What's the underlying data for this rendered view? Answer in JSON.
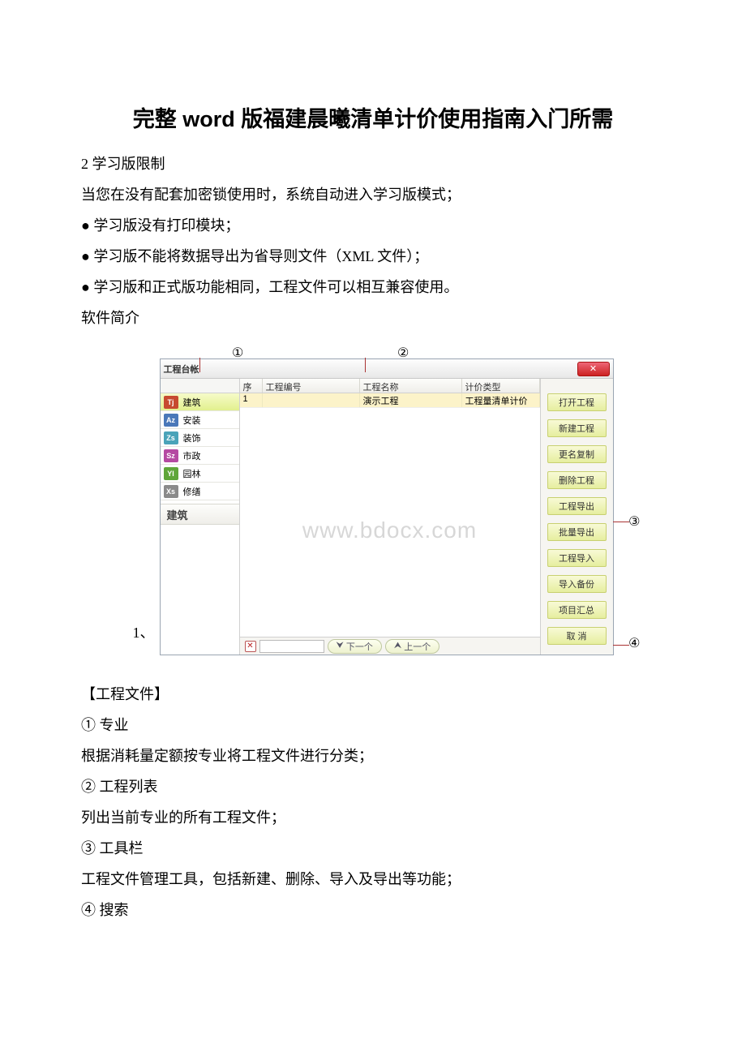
{
  "title": "完整 word 版福建晨曦清单计价使用指南入门所需",
  "intro": {
    "p1": "2 学习版限制",
    "p2": "当您在没有配套加密锁使用时，系统自动进入学习版模式；",
    "b1": "● 学习版没有打印模块；",
    "b2": "● 学习版不能将数据导出为省导则文件（XML 文件）；",
    "b3": "● 学习版和正式版功能相同，工程文件可以相互兼容使用。",
    "p3": "软件简介"
  },
  "markers": {
    "m1": "①",
    "m2": "②",
    "m3": "③",
    "m4": "④"
  },
  "shot": {
    "title": "工程台帐",
    "categories": [
      {
        "code": "Tj",
        "label": "建筑",
        "color": "#c74a2f",
        "selected": true
      },
      {
        "code": "Az",
        "label": "安装",
        "color": "#4a78b9",
        "selected": false
      },
      {
        "code": "Zs",
        "label": "装饰",
        "color": "#4aa3b9",
        "selected": false
      },
      {
        "code": "Sz",
        "label": "市政",
        "color": "#b54aa2",
        "selected": false
      },
      {
        "code": "Yl",
        "label": "园林",
        "color": "#5fa63a",
        "selected": false
      },
      {
        "code": "Xs",
        "label": "修缮",
        "color": "#8a8a8a",
        "selected": false
      }
    ],
    "cat_footer": "建筑",
    "headers": {
      "no": "序号",
      "code": "工程编号",
      "name": "工程名称",
      "type": "计价类型"
    },
    "rows": [
      {
        "no": "1",
        "code": "",
        "name": "演示工程",
        "type": "工程量清单计价"
      }
    ],
    "buttons": [
      "打开工程",
      "新建工程",
      "更名复制",
      "删除工程",
      "工程导出",
      "批量导出",
      "工程导入",
      "导入备份",
      "项目汇总",
      "取    消"
    ],
    "footer": {
      "next": "下一个",
      "prev": "上一个"
    },
    "watermark": "www.bdocx.com"
  },
  "caption": "1、",
  "body2": {
    "h": "【工程文件】",
    "s1_h": "① 专业",
    "s1_b": "根据消耗量定额按专业将工程文件进行分类；",
    "s2_h": "② 工程列表",
    "s2_b": "列出当前专业的所有工程文件；",
    "s3_h": "③ 工具栏",
    "s3_b": "工程文件管理工具，包括新建、删除、导入及导出等功能；",
    "s4_h": "④ 搜索"
  }
}
